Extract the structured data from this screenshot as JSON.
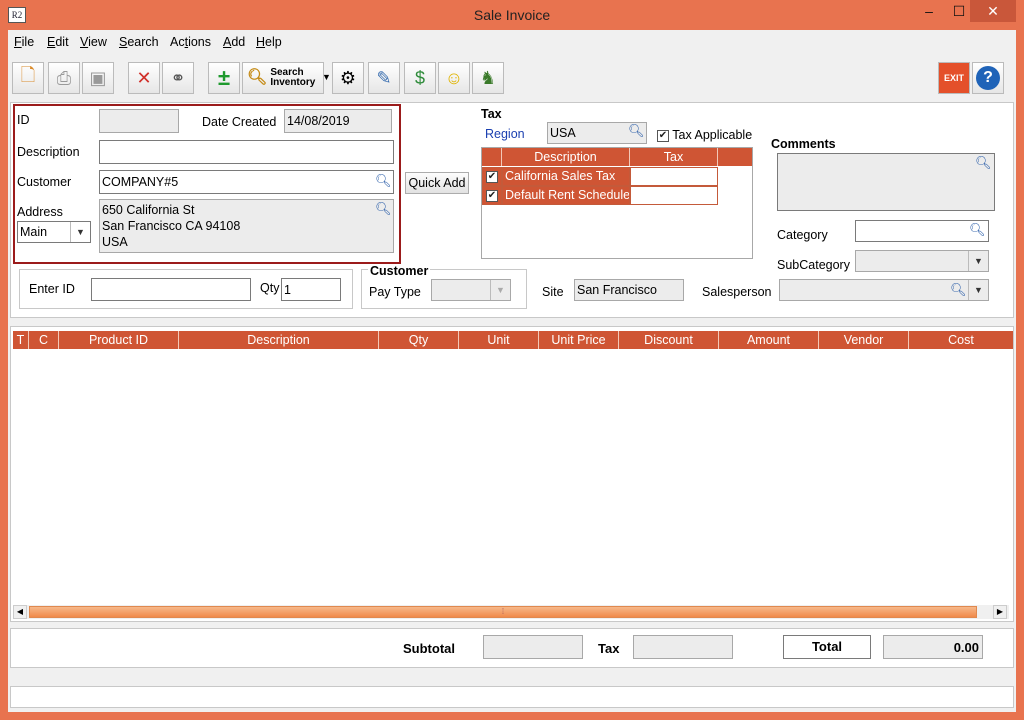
{
  "window": {
    "title": "Sale Invoice",
    "app_icon": "R2",
    "minimize": "–",
    "maximize": "☐",
    "close": "✕"
  },
  "menu": [
    {
      "pre": "",
      "u": "F",
      "post": "ile"
    },
    {
      "pre": "",
      "u": "E",
      "post": "dit"
    },
    {
      "pre": "",
      "u": "V",
      "post": "iew"
    },
    {
      "pre": "",
      "u": "S",
      "post": "earch"
    },
    {
      "pre": "Ac",
      "u": "t",
      "post": "ions"
    },
    {
      "pre": "",
      "u": "A",
      "post": "dd"
    },
    {
      "pre": "",
      "u": "H",
      "post": "elp"
    }
  ],
  "toolbar": {
    "search_inventory_line1": "Search",
    "search_inventory_line2": "Inventory",
    "exit_label": "EXIT",
    "help_label": "?"
  },
  "header": {
    "id_label": "ID",
    "id_value": "",
    "date_created_label": "Date Created",
    "date_created_value": "14/08/2019",
    "description_label": "Description",
    "description_value": "",
    "customer_label": "Customer",
    "customer_value": "COMPANY#5",
    "quick_add_label": "Quick Add",
    "address_label": "Address",
    "address_type": "Main",
    "address_lines": [
      "650 California St",
      "San Francisco CA 94108",
      "USA"
    ]
  },
  "tax": {
    "section_label": "Tax",
    "region_label": "Region",
    "region_value": "USA",
    "tax_applicable_label": "Tax Applicable",
    "tax_applicable": true,
    "columns": [
      "Description",
      "Tax"
    ],
    "rows": [
      {
        "description": "California Sales Tax",
        "tax": "",
        "checked": true
      },
      {
        "description": "Default Rent Schedule",
        "tax": "",
        "checked": true
      }
    ]
  },
  "comments": {
    "label": "Comments",
    "value": ""
  },
  "classification": {
    "category_label": "Category",
    "category_value": "",
    "subcategory_label": "SubCategory",
    "subcategory_value": ""
  },
  "entry": {
    "enter_id_label": "Enter ID",
    "enter_id_value": "",
    "qty_label": "Qty",
    "qty_value": "1"
  },
  "customer_box": {
    "label": "Customer",
    "pay_type_label": "Pay Type",
    "pay_type_value": ""
  },
  "site": {
    "label": "Site",
    "value": "San Francisco"
  },
  "salesperson": {
    "label": "Salesperson",
    "value": ""
  },
  "grid": {
    "columns": [
      "T",
      "C",
      "Product ID",
      "Description",
      "Qty",
      "Unit",
      "Unit Price",
      "Discount",
      "Amount",
      "Vendor",
      "Cost"
    ]
  },
  "totals": {
    "subtotal_label": "Subtotal",
    "subtotal_value": "",
    "tax_label": "Tax",
    "tax_value": "",
    "total_label": "Total",
    "total_value": "0.00"
  },
  "status": {
    "text": ""
  },
  "colors": {
    "accent": "#cf5534",
    "window_frame": "#e8734f",
    "highlight_border": "#9b1b1b"
  }
}
